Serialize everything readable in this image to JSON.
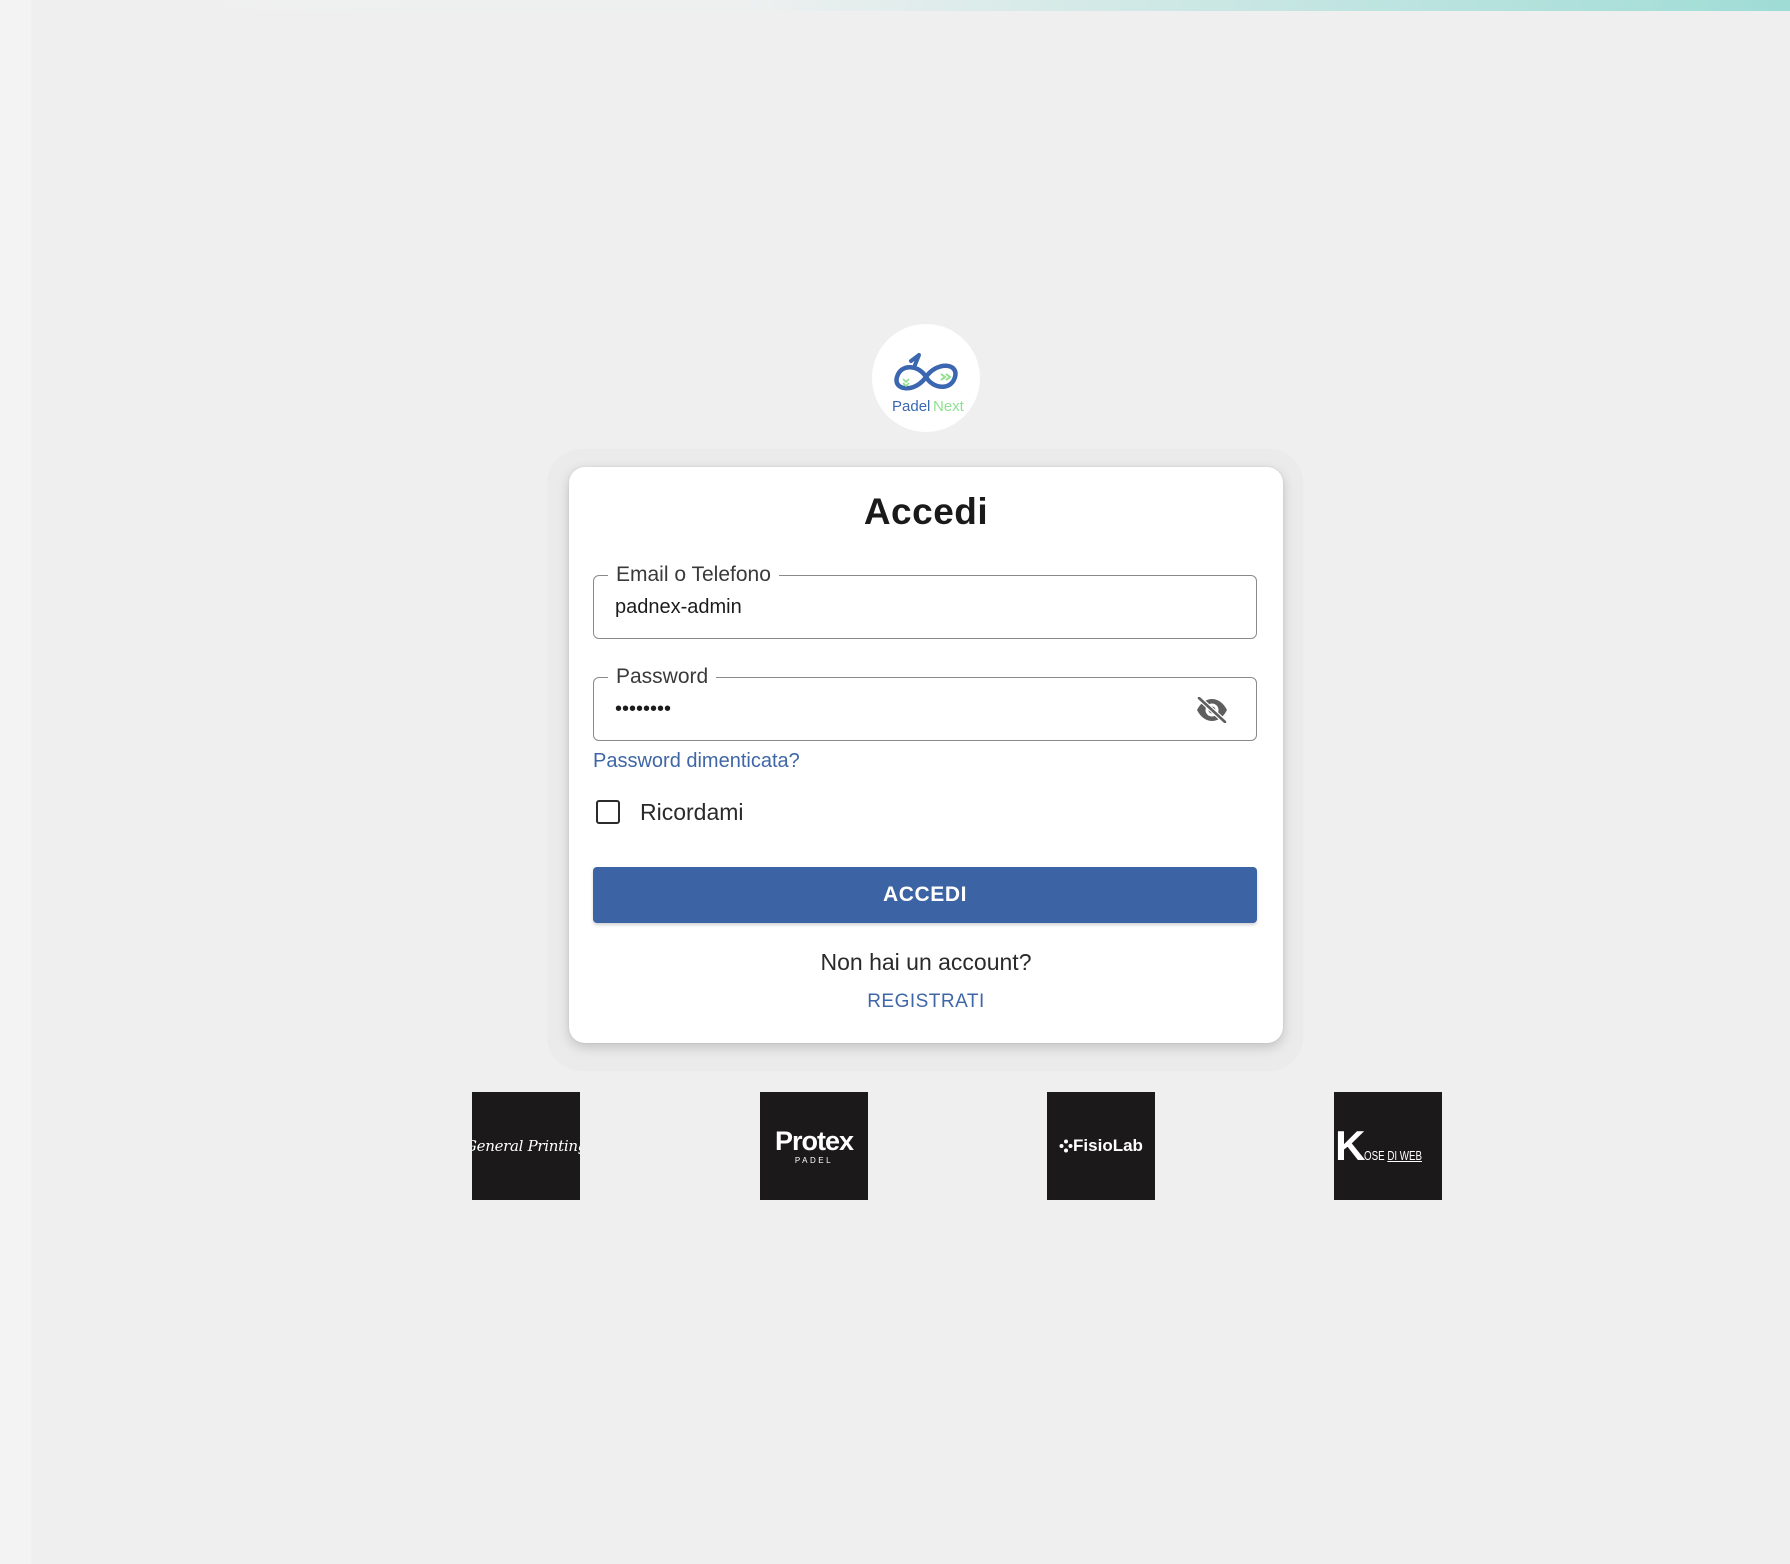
{
  "brand": {
    "logo_text_primary": "Padel",
    "logo_text_secondary": "Next",
    "logo_color_primary": "#3a67b0",
    "logo_color_secondary": "#8fe08f"
  },
  "login": {
    "title": "Accedi",
    "email_field": {
      "label": "Email o Telefono",
      "value": "padnex-admin"
    },
    "password_field": {
      "label": "Password",
      "value": "••••••••",
      "toggle_icon": "eye-off-icon"
    },
    "forgot_password_link": "Password dimenticata?",
    "remember_me": {
      "label": "Ricordami",
      "checked": false
    },
    "submit_label": "ACCEDI",
    "no_account_text": "Non hai un account?",
    "register_link": "REGISTRATI"
  },
  "sponsors": [
    {
      "name": "General Printing",
      "logo_text": "General Printing"
    },
    {
      "name": "Protex Padel",
      "logo_text": "Protex",
      "logo_subtext": "PADEL"
    },
    {
      "name": "FisioLab",
      "logo_text": "FisioLab"
    },
    {
      "name": "Kose di Web",
      "logo_mark": "K",
      "logo_text": "OSE",
      "logo_text_underlined": "DI WEB"
    }
  ],
  "colors": {
    "background": "#efefef",
    "card": "#ffffff",
    "primary_button": "#3c63a3",
    "link": "#3f66a6",
    "sponsor_tile": "#1c191b",
    "top_accent": "#9fdcd6"
  }
}
